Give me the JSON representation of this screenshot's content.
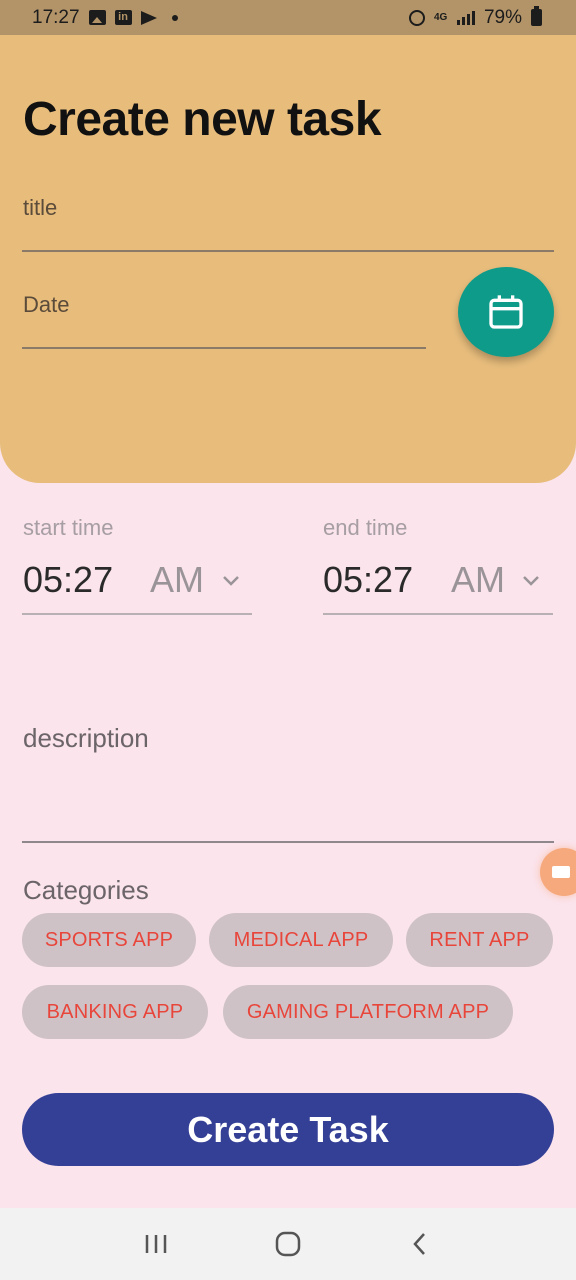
{
  "status_bar": {
    "time": "17:27",
    "battery": "79%",
    "network": "4G"
  },
  "header": {
    "title": "Create new task",
    "title_field_label": "title",
    "date_field_label": "Date",
    "calendar_icon": "calendar-icon",
    "background": "#e8bd7c"
  },
  "times": {
    "start": {
      "label": "start time",
      "value": "05:27",
      "period": "AM"
    },
    "end": {
      "label": "end time",
      "value": "05:27",
      "period": "AM"
    }
  },
  "description": {
    "label": "description"
  },
  "categories": {
    "label": "Categories",
    "items": [
      "SPORTS APP",
      "MEDICAL APP",
      "RENT APP",
      "BANKING APP",
      "GAMING PLATFORM APP"
    ]
  },
  "actions": {
    "create_label": "Create Task"
  },
  "colors": {
    "accent": "#343f96",
    "fab": "#0f9b8a",
    "chip_text": "#e8453b",
    "page_background": "#fbe4ec"
  },
  "nav": {
    "recent_icon": "recent-apps-icon",
    "home_icon": "home-icon",
    "back_icon": "back-icon"
  }
}
